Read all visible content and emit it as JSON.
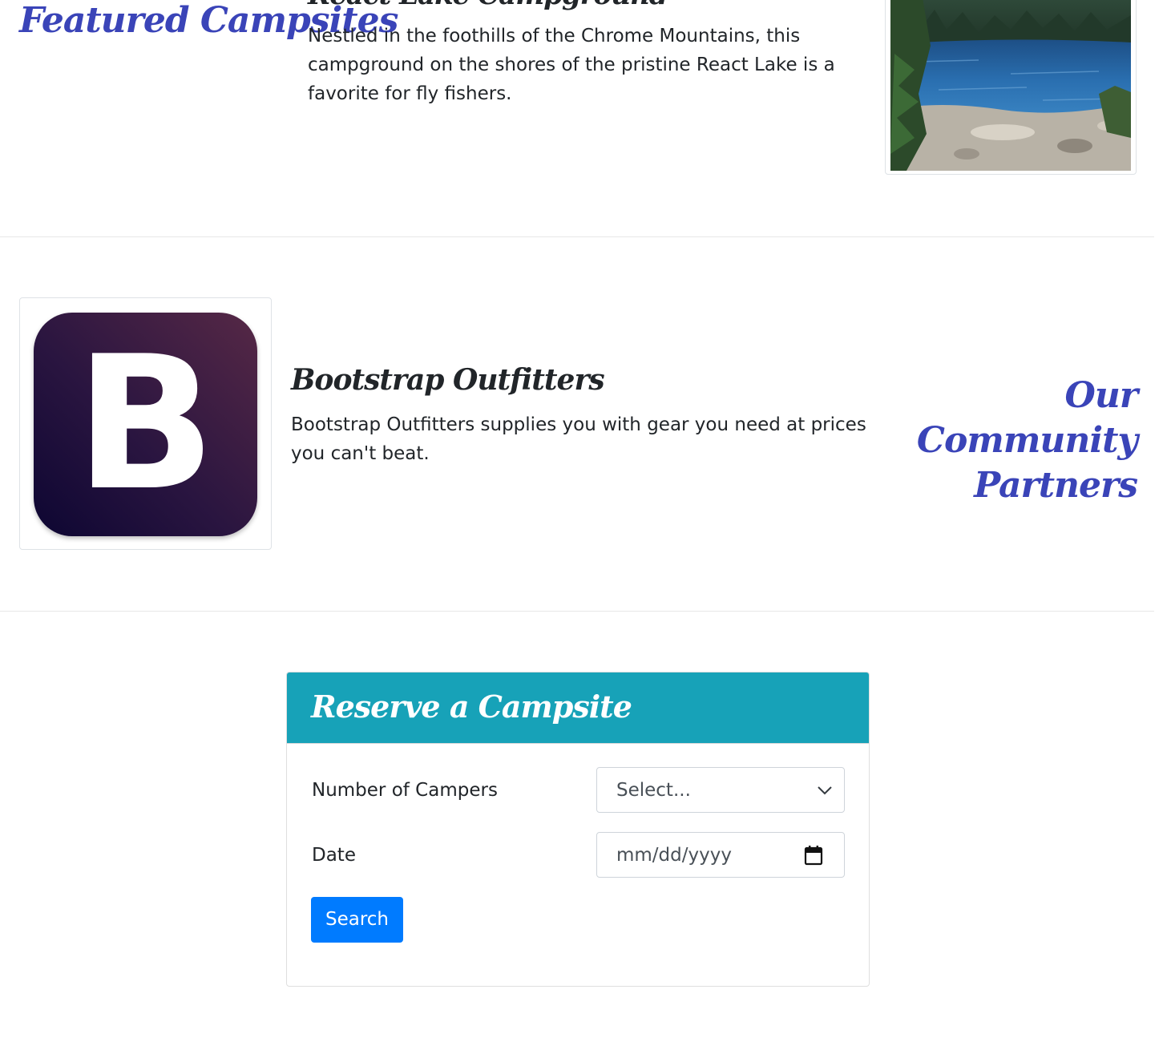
{
  "featured": {
    "heading": "Featured Campsites",
    "campsite_title": "React Lake Campground",
    "campsite_description": "Nestled in the foothills of the Chrome Mountains, this campground on the shores of the pristine React Lake is a favorite for fly fishers."
  },
  "partners": {
    "heading": "Our Community Partners",
    "partner_logo_letter": "B",
    "partner_title": "Bootstrap Outfitters",
    "partner_description": "Bootstrap Outfitters supplies you with gear you need at prices you can't beat."
  },
  "reserve": {
    "title": "Reserve a Campsite",
    "campers_label": "Number of Campers",
    "campers_select_value": "Select...",
    "date_label": "Date",
    "date_placeholder": "mm/dd/yyyy",
    "search_label": "Search"
  },
  "icons": {
    "select": "chevron-down-icon",
    "date": "calendar-icon"
  },
  "colors": {
    "heading_accent": "#3a44b8",
    "card_header": "#17a2b8",
    "primary_button": "#007bff",
    "partner_logo_dark": "#0d0632",
    "partner_logo_light": "#562846"
  }
}
